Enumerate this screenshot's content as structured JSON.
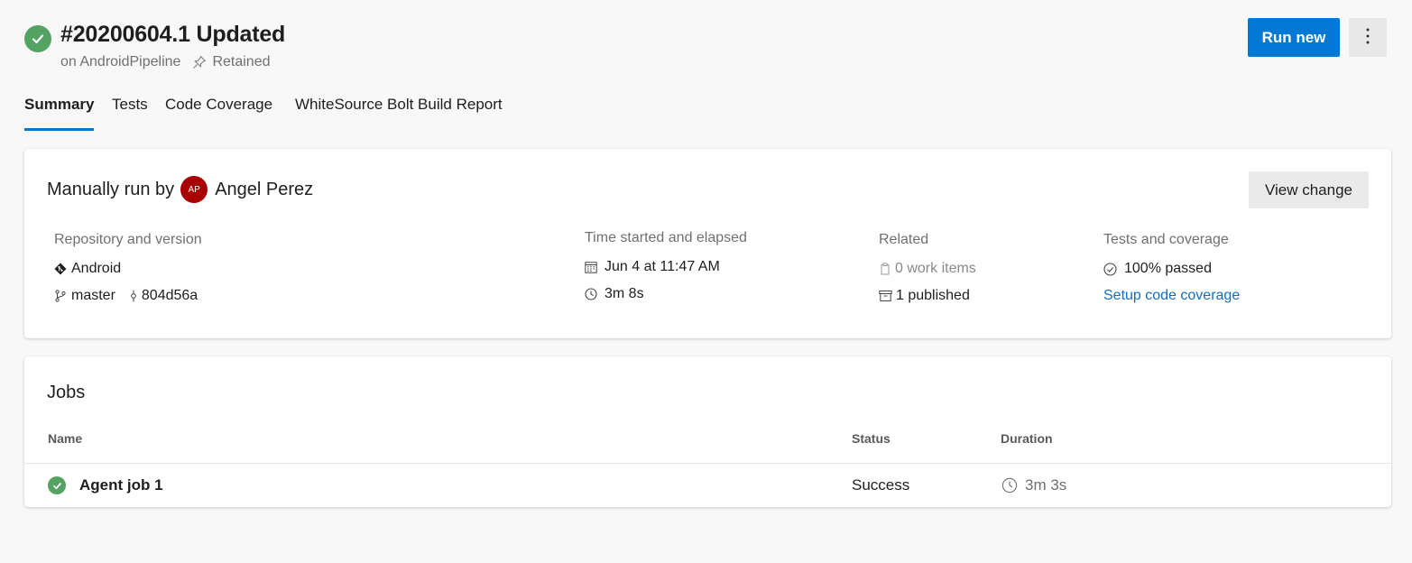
{
  "header": {
    "title": "#20200604.1 Updated",
    "pipeline": "on AndroidPipeline",
    "retained": "Retained",
    "run_new_label": "Run new"
  },
  "tabs": [
    {
      "label": "Summary",
      "active": true
    },
    {
      "label": "Tests"
    },
    {
      "label": "Code Coverage"
    },
    {
      "label": "WhiteSource Bolt Build Report"
    }
  ],
  "summary": {
    "run_by_prefix": "Manually run by",
    "avatar_initials": "AP",
    "user_name": "Angel Perez",
    "view_change_label": "View change",
    "repository": {
      "label": "Repository and version",
      "repo": "Android",
      "branch": "master",
      "commit": "804d56a"
    },
    "time": {
      "label": "Time started and elapsed",
      "started": "Jun 4 at 11:47 AM",
      "elapsed": "3m 8s"
    },
    "related": {
      "label": "Related",
      "work_items": "0 work items",
      "published": "1 published"
    },
    "tests": {
      "label": "Tests and coverage",
      "passed": "100% passed",
      "coverage_link": "Setup code coverage"
    }
  },
  "jobs": {
    "title": "Jobs",
    "columns": [
      "Name",
      "Status",
      "Duration"
    ],
    "rows": [
      {
        "name": "Agent job 1",
        "status": "Success",
        "duration": "3m 3s"
      }
    ]
  },
  "colors": {
    "accent": "#0078d4",
    "success": "#55a362",
    "avatar": "#a80000",
    "link": "#106ebe"
  }
}
